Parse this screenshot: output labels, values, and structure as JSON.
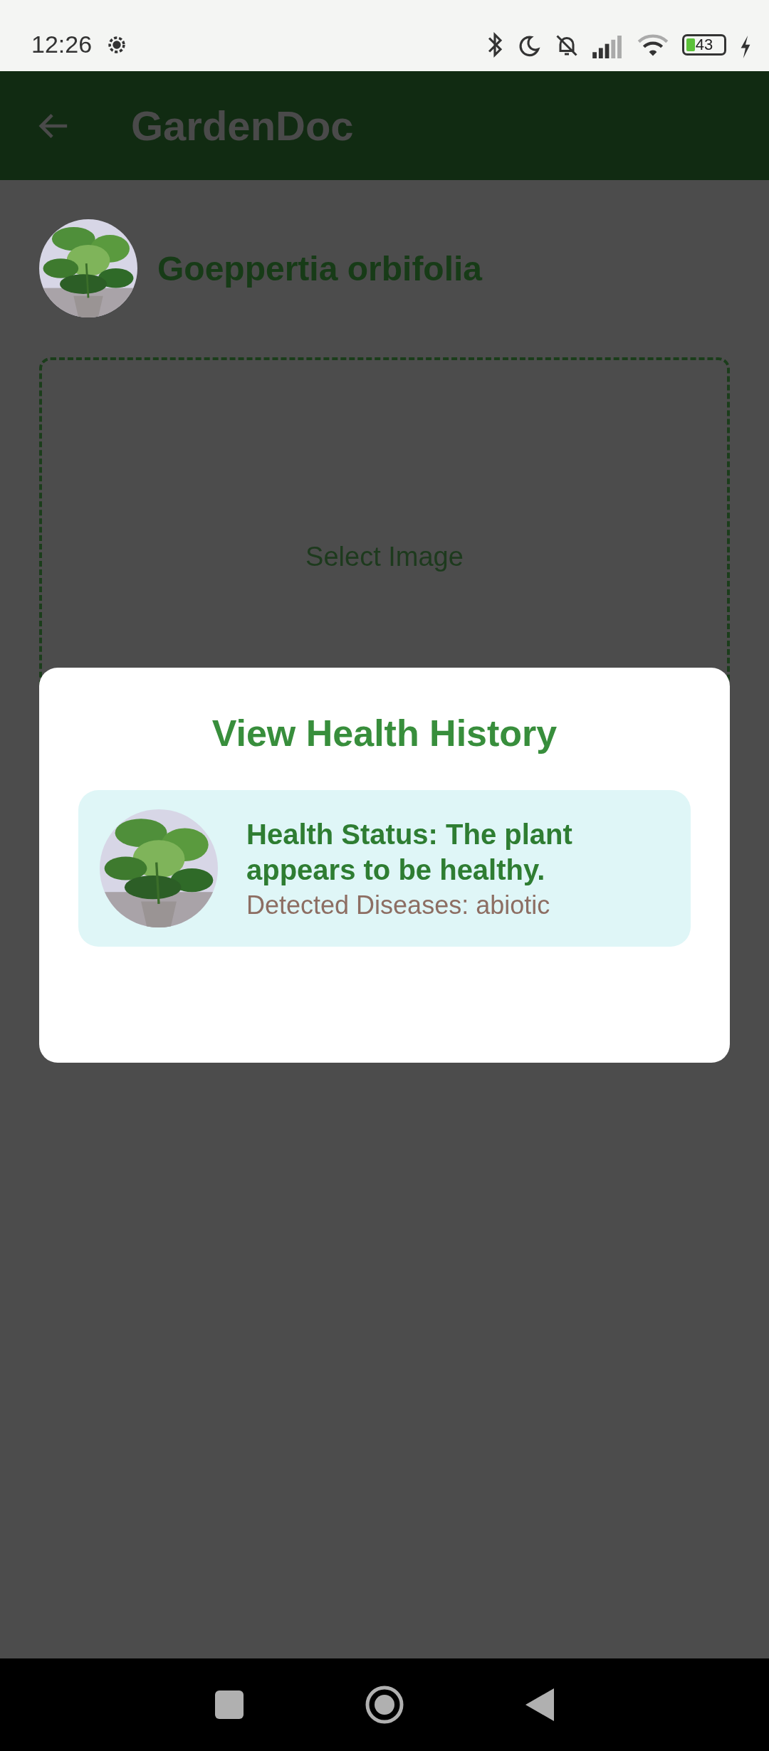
{
  "status_bar": {
    "time": "12:26",
    "battery": "43"
  },
  "app_bar": {
    "title": "GardenDoc"
  },
  "plant": {
    "name": "Goeppertia orbifolia"
  },
  "image_picker": {
    "label": "Select Image"
  },
  "dialog": {
    "title": "View Health History",
    "entries": [
      {
        "status": "Health Status: The plant appears to be healthy.",
        "diseases": "Detected Diseases: abiotic"
      }
    ]
  }
}
